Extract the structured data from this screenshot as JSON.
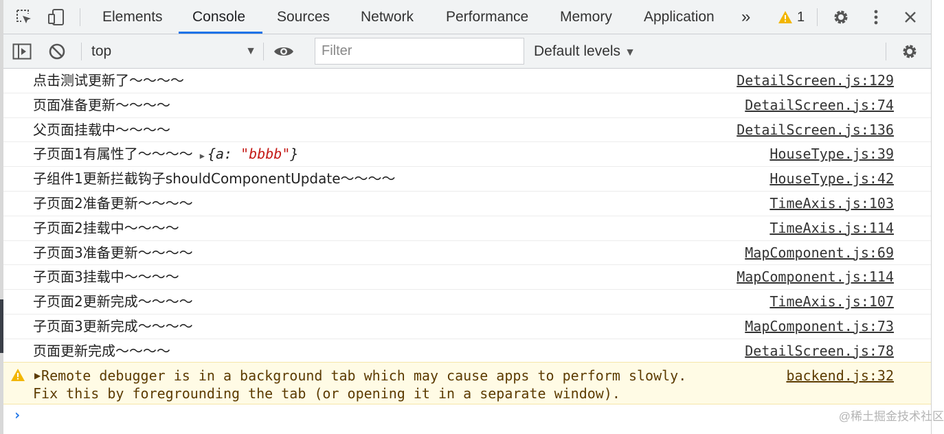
{
  "tabs": [
    {
      "label": "Elements"
    },
    {
      "label": "Console"
    },
    {
      "label": "Sources"
    },
    {
      "label": "Network"
    },
    {
      "label": "Performance"
    },
    {
      "label": "Memory"
    },
    {
      "label": "Application"
    }
  ],
  "more_tabs_label": "»",
  "warning_count": "1",
  "toolbar": {
    "context": "top",
    "filter_placeholder": "Filter",
    "levels_label": "Default levels"
  },
  "logs": [
    {
      "text": "点击测试更新了～～～～",
      "source": "DetailScreen.js:129"
    },
    {
      "text": "页面准备更新～～～～",
      "source": "DetailScreen.js:74"
    },
    {
      "text": "父页面挂载中～～～～",
      "source": "DetailScreen.js:136"
    },
    {
      "text": "子页面1有属性了～～～～",
      "source": "HouseType.js:39",
      "object": {
        "open": "{",
        "key": "a: ",
        "value": "\"bbbb\"",
        "close": "}"
      }
    },
    {
      "text": "子组件1更新拦截钩子shouldComponentUpdate～～～～",
      "source": "HouseType.js:42"
    },
    {
      "text": "子页面2准备更新～～～～",
      "source": "TimeAxis.js:103"
    },
    {
      "text": "子页面2挂载中～～～～",
      "source": "TimeAxis.js:114"
    },
    {
      "text": "子页面3准备更新～～～～",
      "source": "MapComponent.js:69"
    },
    {
      "text": "子页面3挂载中～～～～",
      "source": "MapComponent.js:114"
    },
    {
      "text": "子页面2更新完成～～～～",
      "source": "TimeAxis.js:107"
    },
    {
      "text": "子页面3更新完成～～～～",
      "source": "MapComponent.js:73"
    },
    {
      "text": "页面更新完成～～～～",
      "source": "DetailScreen.js:78"
    }
  ],
  "warning": {
    "line1": " Remote debugger is in a background tab which may cause apps to perform slowly.",
    "line2": "Fix this by foregrounding the tab (or opening it in a separate window).",
    "source": "backend.js:32"
  },
  "prompt": "›",
  "watermark": "@稀土掘金技术社区",
  "colors": {
    "accent": "#1a73e8",
    "warning_bg": "#fffbe5",
    "warning_text": "#5c3b00",
    "string_value": "#c41a16",
    "warning_icon": "#f2b600"
  }
}
